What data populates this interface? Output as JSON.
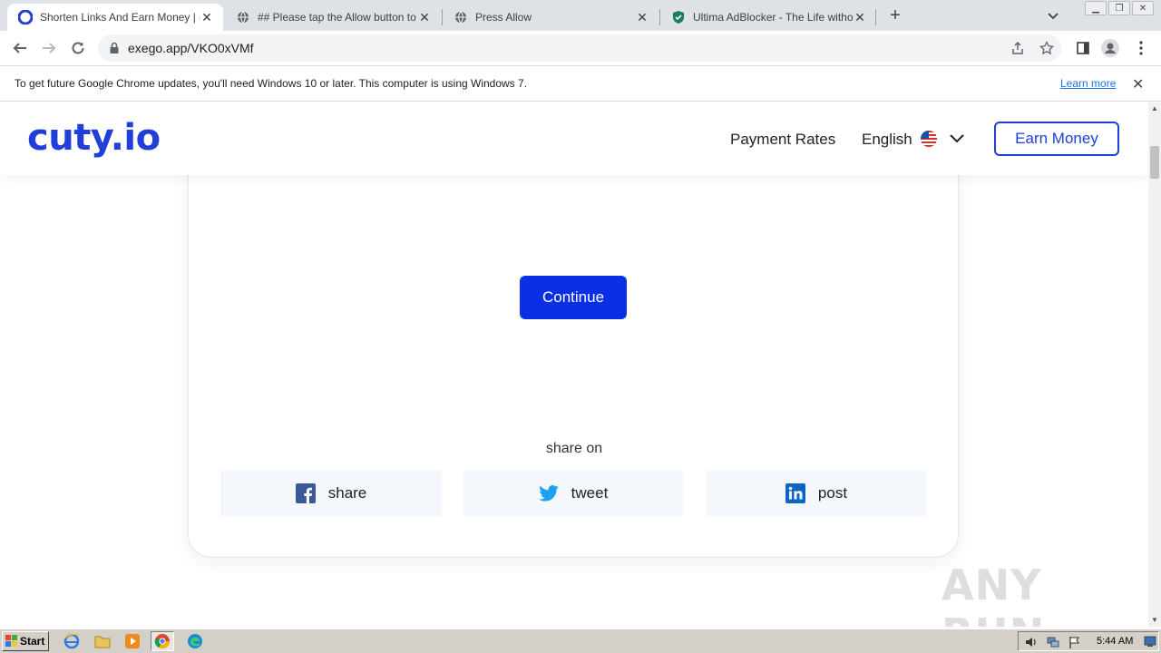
{
  "browser": {
    "tabs": [
      {
        "title": "Shorten Links And Earn Money | cuty",
        "active": true
      },
      {
        "title": "## Please tap the Allow button to co",
        "active": false
      },
      {
        "title": "Press Allow",
        "active": false
      },
      {
        "title": "Ultima AdBlocker - The Life without A",
        "active": false
      }
    ],
    "url": "exego.app/VKO0xVMf",
    "infobar_message": "To get future Google Chrome updates, you'll need Windows 10 or later. This computer is using Windows 7.",
    "infobar_link": "Learn more"
  },
  "site": {
    "logo": "cuty.io",
    "nav": {
      "payment_rates": "Payment Rates",
      "language": "English",
      "earn_button": "Earn Money"
    },
    "continue_label": "Continue",
    "share_heading": "share on",
    "share_buttons": [
      {
        "label": "share",
        "icon": "facebook-icon"
      },
      {
        "label": "tweet",
        "icon": "twitter-icon"
      },
      {
        "label": "post",
        "icon": "linkedin-icon"
      }
    ]
  },
  "watermark": "ANY RUN",
  "taskbar": {
    "start_label": "Start",
    "clock": "5:44 AM"
  },
  "colors": {
    "brand": "#1f3fd8",
    "continue_bg": "#0a2fe6",
    "facebook": "#3b5998",
    "twitter": "#1da1f2",
    "linkedin": "#0a66c2"
  }
}
